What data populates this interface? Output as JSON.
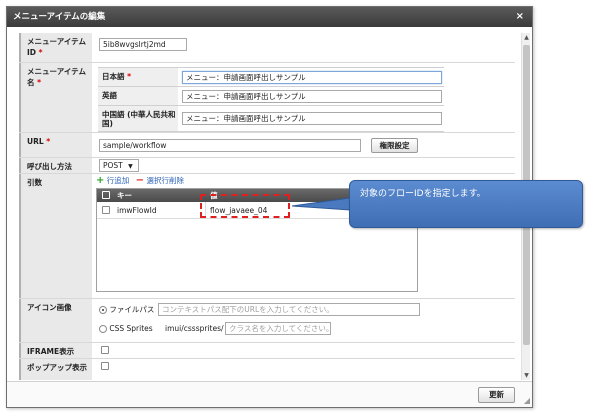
{
  "dialog": {
    "title": "メニューアイテムの編集",
    "close_glyph": "×"
  },
  "form": {
    "menu_item_id": {
      "label": "メニューアイテムID",
      "required_mark": "*",
      "value": "5ib8wvgslrtj2md"
    },
    "menu_item_name": {
      "label": "メニューアイテム名",
      "required_mark": "*",
      "languages": [
        {
          "label": "日本語",
          "required_mark": "*",
          "value": "メニュー：申請画面呼出しサンプル"
        },
        {
          "label": "英語",
          "required_mark": "",
          "value": "メニュー：申請画面呼出しサンプル"
        },
        {
          "label": "中国語 (中華人民共和国)",
          "required_mark": "",
          "value": "メニュー：申請画面呼出しサンプル"
        }
      ]
    },
    "url": {
      "label": "URL",
      "required_mark": "*",
      "value": "sample/workflow",
      "button": "権限設定"
    },
    "call_method": {
      "label": "呼び出し方法",
      "value": "POST",
      "caret": "▼"
    },
    "args": {
      "label": "引数",
      "add_label": "行追加",
      "delete_label": "選択行削除",
      "columns": [
        "キー",
        "値"
      ],
      "rows": [
        {
          "key": "imwFlowId",
          "value": "flow_javaee_04"
        }
      ]
    },
    "icon_image": {
      "label": "アイコン画像",
      "file_path": {
        "label": "ファイルパス",
        "placeholder": "コンテキストパス配下のURLを入力してください。"
      },
      "css_sprites": {
        "label": "CSS Sprites",
        "prefix": "imui/csssprites/",
        "placeholder": "クラス名を入力してください。"
      }
    },
    "iframe": {
      "label": "IFRAME表示"
    },
    "popup": {
      "label": "ポップアップ表示"
    }
  },
  "footer": {
    "update_button": "更新"
  },
  "callout": {
    "text": "対象のフローIDを指定します。"
  }
}
